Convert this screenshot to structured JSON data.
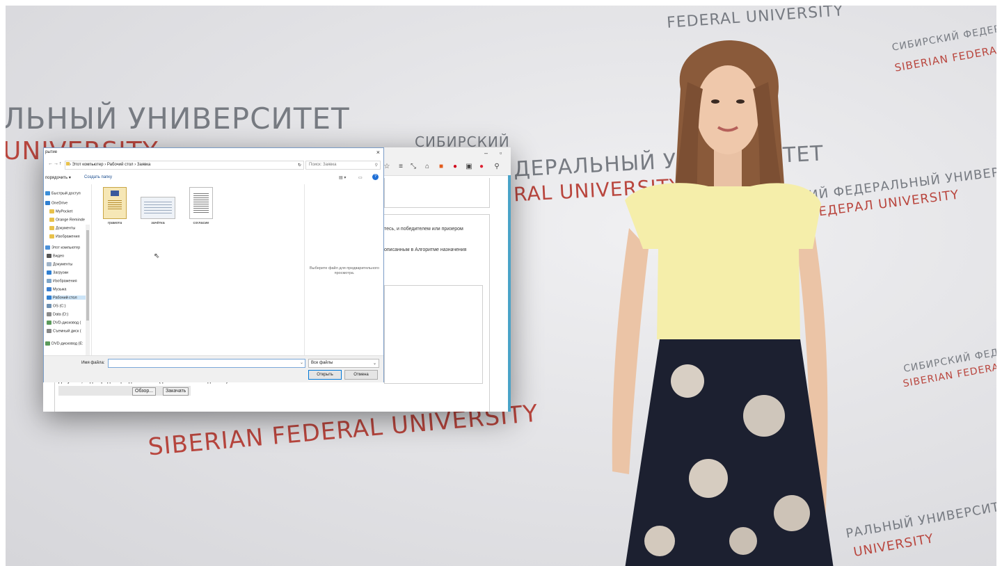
{
  "wall": {
    "top_university": "FEDERAL UNIVERSITY",
    "left_ru_big": "ЛЬНЫЙ УНИВЕРСИТЕТ",
    "left_en_red": "UNIVERSITY",
    "mid_ru_grey": "СИБИРСКИЙ",
    "mid_ru_line": "ДЕРАЛЬНЫЙ УНИВЕРСИТЕТ",
    "mid_en_red": "RAL UNIVERSITY",
    "right_ru": "СИБИРСКИЙ ФЕДЕРАЛЬНЫЙ УНИВ",
    "right_en": "SIBERIAN FEDERAL UNIVERSITY",
    "right2_ru": "СКИЙ ФЕДЕРАЛЬНЫЙ УНИВЕРСИТЕТ",
    "right2_en": "ЕДЕРАЛ UNIVERSITY",
    "low_right_ru": "СИБИРСКИЙ ФЕДЕРАЛЬНЫЙ УНИВЕРСИТЕТ",
    "low_right_en": "SIBERIAN FEDERAL UNIVERSITY",
    "bottom_en_red": "SIBERIAN FEDERAL UNIVERSITY",
    "bottom_right_ru": "РАЛЬНЫЙ УНИВЕРСИТЕТ",
    "bottom_right_en": "UNIVERSITY"
  },
  "dialog": {
    "title": "рытие",
    "close": "×",
    "path": "› Этот компьютер › Рабочий стол › Заявка",
    "search_placeholder": "Поиск: Заявка",
    "organize": "порядочить ▾",
    "new_folder": "Создать папку",
    "nav_items": [
      "Быстрый доступ",
      "OneDrive",
      "MyPocket",
      "Orange Reminde",
      "Документы",
      "Изображения",
      "Этот компьютер",
      "Видео",
      "Документы",
      "Загрузки",
      "Изображения",
      "Музыка",
      "Рабочий стол",
      "OS (C:)",
      "Data (D:)",
      "DVD-дисковод (",
      "Съемный диск (",
      "DVD-дисковод (E:"
    ],
    "files": [
      "грамота",
      "зачётка",
      "согласие"
    ],
    "preview_text": "Выберите файл для предварительного просмотра.",
    "filename_label": "Имя файла:",
    "filename_value": "",
    "filetype": "Все файлы",
    "open_button": "Открыть",
    "cancel_button": "Отмена"
  },
  "page": {
    "text_1": "тесь, и победителем или призером",
    "text_2": "описанным в Алгоритме назначения",
    "upload_label": "Документ, подтверждающий достижение (файл JPG или PDF до 5 Мб)",
    "browse_button": "Обзор...",
    "upload_button": "Закачать"
  },
  "browser": {
    "minimize": "–",
    "maximize": "▫"
  }
}
